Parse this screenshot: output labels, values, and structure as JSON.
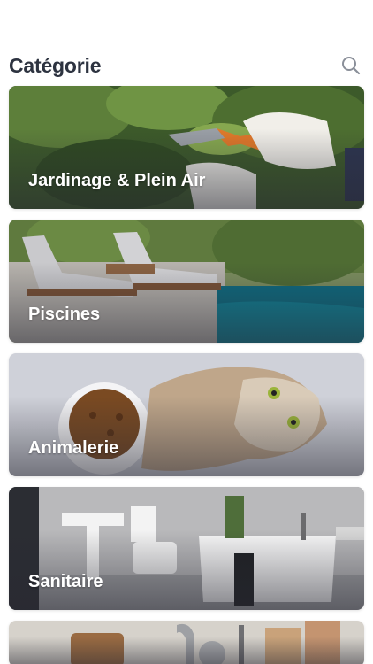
{
  "header": {
    "title": "Catégorie",
    "search_icon": "search-icon"
  },
  "categories": [
    {
      "label": "Jardinage & Plein Air",
      "image": "garden-pruning-image"
    },
    {
      "label": "Piscines",
      "image": "pool-loungers-image"
    },
    {
      "label": "Animalerie",
      "image": "cat-food-bowl-image"
    },
    {
      "label": "Sanitaire",
      "image": "bathroom-image"
    },
    {
      "label": "",
      "image": "kitchen-utensils-image"
    }
  ]
}
